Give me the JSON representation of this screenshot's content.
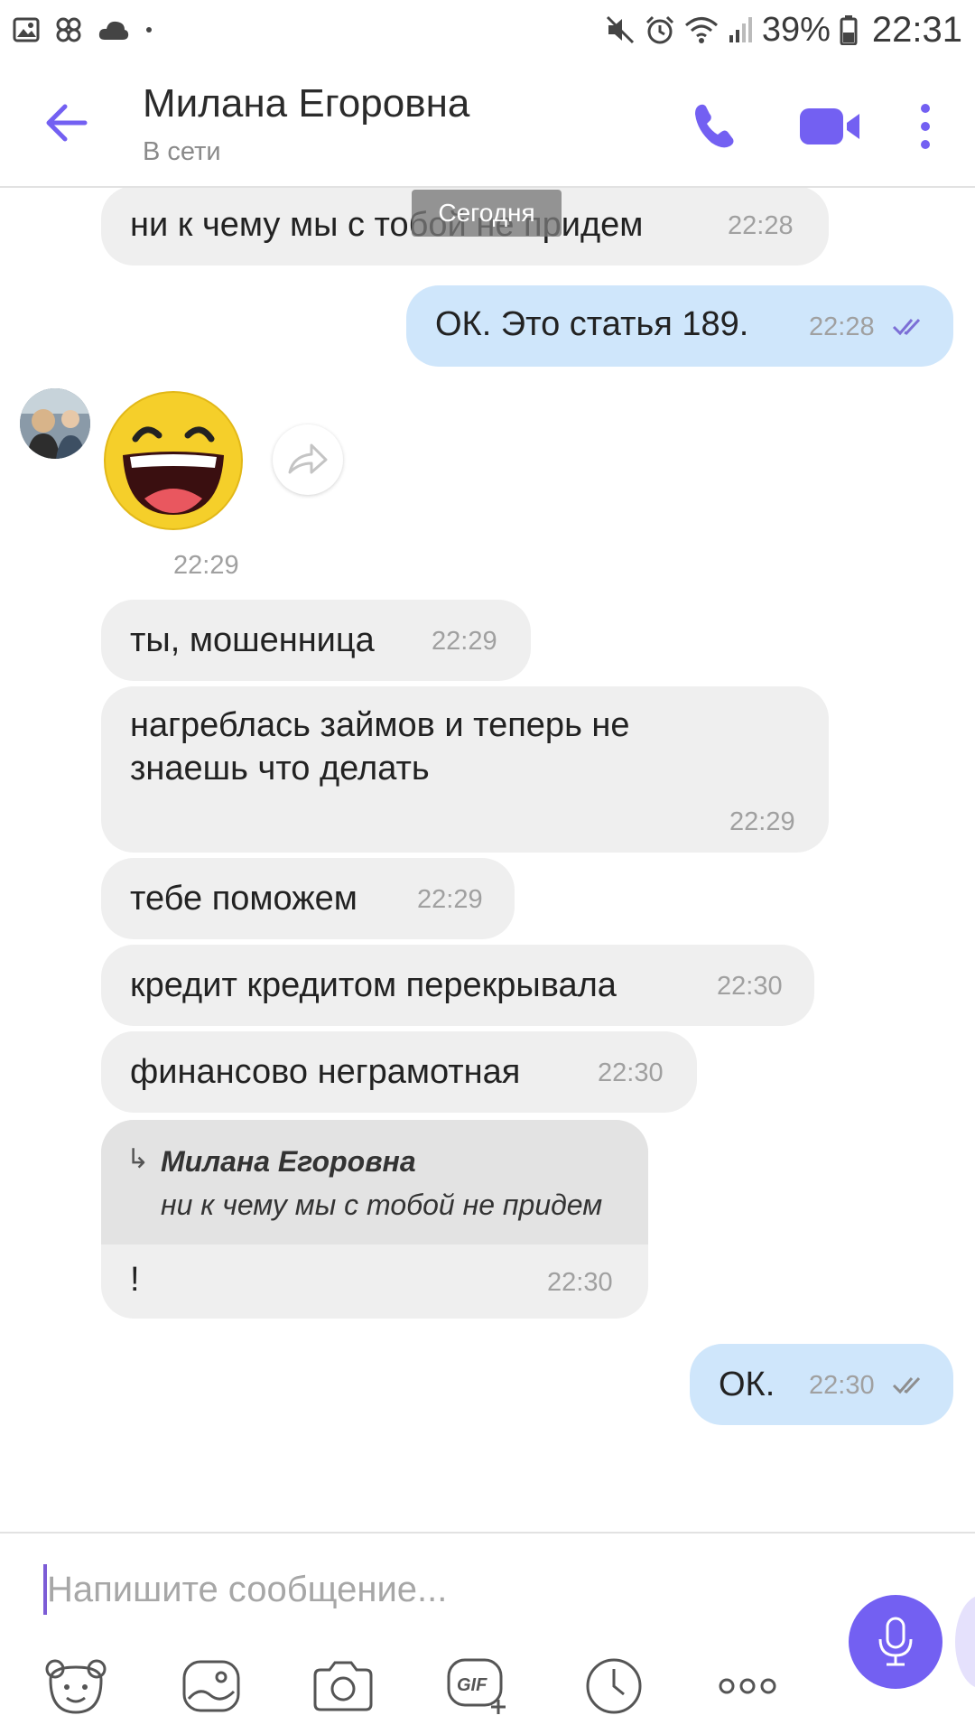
{
  "status_bar": {
    "battery_percent": "39%",
    "time": "22:31",
    "left_icons": [
      "gallery-icon",
      "fan-icon",
      "cloud-icon",
      "dot-icon"
    ],
    "right_icons": [
      "mute-icon",
      "alarm-icon",
      "wifi-icon",
      "signal-icon",
      "battery-icon"
    ]
  },
  "header": {
    "contact_name": "Милана Егоровна",
    "status": "В сети"
  },
  "chat": {
    "date_separator": "Сегодня",
    "messages": [
      {
        "direction": "in",
        "text": "ни к чему мы с тобой не придем",
        "time": "22:28"
      },
      {
        "direction": "out",
        "text": "ОК. Это статья 189.",
        "time": "22:28"
      },
      {
        "direction": "in",
        "type": "sticker",
        "sticker": "laughing-face",
        "time": "22:29"
      },
      {
        "direction": "in",
        "text": "ты, мошенница",
        "time": "22:29"
      },
      {
        "direction": "in",
        "text_lines": [
          "нагреблась займов и теперь не",
          "знаешь что делать"
        ],
        "time": "22:29"
      },
      {
        "direction": "in",
        "text": "тебе поможем",
        "time": "22:29"
      },
      {
        "direction": "in",
        "text": "кредит кредитом перекрывала",
        "time": "22:30"
      },
      {
        "direction": "in",
        "text": "финансово неграмотная",
        "time": "22:30"
      },
      {
        "direction": "in",
        "reply_to": {
          "name": "Милана Егоровна",
          "text": "ни к чему мы с тобой не придем"
        },
        "text": "!",
        "time": "22:30"
      },
      {
        "direction": "out",
        "text": "ОК.",
        "time": "22:30"
      }
    ]
  },
  "composer": {
    "placeholder": "Напишите сообщение..."
  },
  "colors": {
    "accent": "#7360f2",
    "incoming_bubble": "#efefef",
    "outgoing_bubble": "#cfe6fb",
    "timestamp": "#a0a0a0"
  }
}
